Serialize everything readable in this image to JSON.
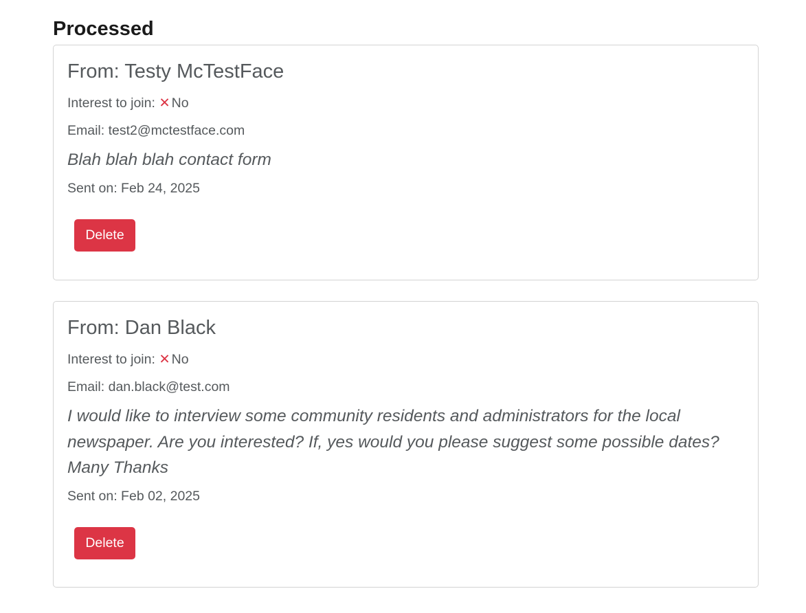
{
  "section": {
    "title": "Processed"
  },
  "messages": [
    {
      "from": "From: Testy McTestFace",
      "interest_label": "Interest to join:",
      "interest_icon": "x-icon",
      "interest_value": "No",
      "email": "Email: test2@mctestface.com",
      "body": "Blah blah blah contact form",
      "sent": "Sent on: Feb 24, 2025",
      "delete_label": "Delete"
    },
    {
      "from": "From: Dan Black",
      "interest_label": "Interest to join:",
      "interest_icon": "x-icon",
      "interest_value": "No",
      "email": "Email: dan.black@test.com",
      "body": "I would like to interview some community residents and administrators for the local newspaper. Are you interested? If, yes would you please suggest some possible dates? Many Thanks",
      "sent": "Sent on: Feb 02, 2025",
      "delete_label": "Delete"
    }
  ],
  "colors": {
    "danger": "#dc3545",
    "text": "#55595c",
    "heading": "#1a1a1a",
    "border": "#d3d3d3"
  }
}
